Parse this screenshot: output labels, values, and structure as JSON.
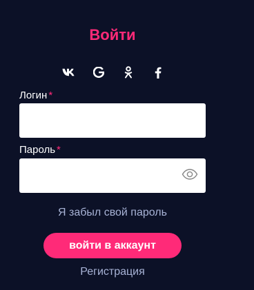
{
  "title": "Войти",
  "social": [
    {
      "icon": "vk-icon"
    },
    {
      "icon": "google-icon"
    },
    {
      "icon": "odnoklassniki-icon"
    },
    {
      "icon": "facebook-icon"
    }
  ],
  "login": {
    "label": "Логин",
    "required_mark": "*",
    "value": ""
  },
  "password": {
    "label": "Пароль",
    "required_mark": "*",
    "value": ""
  },
  "forgot_link": "Я забыл свой пароль",
  "submit_label": "войти в аккаунт",
  "register_link": "Регистрация",
  "colors": {
    "background": "#0c1127",
    "accent": "#ff2a78",
    "link": "#a8b3d6"
  }
}
